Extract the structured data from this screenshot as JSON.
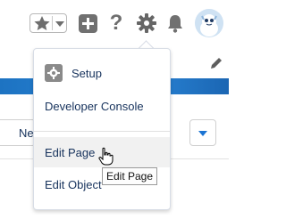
{
  "header": {
    "favorites": {
      "star_icon": "star-icon",
      "caret_icon": "chevron-down-icon"
    },
    "actions": [
      {
        "name": "add-button",
        "icon": "plus-icon"
      },
      {
        "name": "help-button",
        "icon": "question-icon",
        "glyph": "?"
      },
      {
        "name": "setup-gear-button",
        "icon": "gear-icon"
      },
      {
        "name": "notifications-button",
        "icon": "bell-icon"
      },
      {
        "name": "user-avatar",
        "icon": "astro-avatar-icon"
      }
    ]
  },
  "background": {
    "input_text": "Ne"
  },
  "menu": {
    "items": [
      {
        "label": "Setup",
        "icon": "setup-gear-icon"
      },
      {
        "label": "Developer Console"
      },
      {
        "label": "Edit Page"
      },
      {
        "label": "Edit Object"
      }
    ]
  },
  "tooltip": {
    "text": "Edit Page"
  },
  "colors": {
    "icon_gray": "#707070",
    "text_navy": "#16325c",
    "accent_blue": "#1b74d3",
    "hover_bg": "#f1f1f1"
  }
}
